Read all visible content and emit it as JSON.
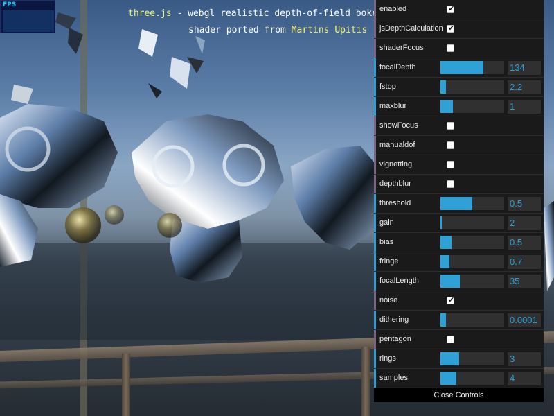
{
  "fps_label": "FPS",
  "info": {
    "line1_link": "three.js",
    "line1_text": " - webgl realistic depth-of-field boke",
    "line2_text": "shader ported from ",
    "line2_link": "Martins Upitis"
  },
  "gui": {
    "close_label": "Close Controls",
    "controls": [
      {
        "label": "enabled",
        "type": "bool",
        "checked": true
      },
      {
        "label": "jsDepthCalculation",
        "type": "bool",
        "checked": true
      },
      {
        "label": "shaderFocus",
        "type": "bool",
        "checked": false
      },
      {
        "label": "focalDepth",
        "type": "num",
        "value": "134",
        "fill": 0.67
      },
      {
        "label": "fstop",
        "type": "num",
        "value": "2.2",
        "fill": 0.09
      },
      {
        "label": "maxblur",
        "type": "num",
        "value": "1",
        "fill": 0.2
      },
      {
        "label": "showFocus",
        "type": "bool",
        "checked": false
      },
      {
        "label": "manualdof",
        "type": "bool",
        "checked": false
      },
      {
        "label": "vignetting",
        "type": "bool",
        "checked": false
      },
      {
        "label": "depthblur",
        "type": "bool",
        "checked": false
      },
      {
        "label": "threshold",
        "type": "num",
        "value": "0.5",
        "fill": 0.5
      },
      {
        "label": "gain",
        "type": "num",
        "value": "2",
        "fill": 0.02
      },
      {
        "label": "bias",
        "type": "num",
        "value": "0.5",
        "fill": 0.17
      },
      {
        "label": "fringe",
        "type": "num",
        "value": "0.7",
        "fill": 0.14
      },
      {
        "label": "focalLength",
        "type": "num",
        "value": "35",
        "fill": 0.3
      },
      {
        "label": "noise",
        "type": "bool",
        "checked": true
      },
      {
        "label": "dithering",
        "type": "num",
        "value": "0.0001",
        "fill": 0.09
      },
      {
        "label": "pentagon",
        "type": "bool",
        "checked": false
      },
      {
        "label": "rings",
        "type": "num",
        "value": "3",
        "fill": 0.29
      },
      {
        "label": "samples",
        "type": "num",
        "value": "4",
        "fill": 0.25
      }
    ]
  },
  "colors": {
    "accent_number": "#2fa1d6",
    "accent_boolean": "#806787",
    "link_yellow": "#f1f17a",
    "fps_cyan": "#12d2ff"
  }
}
